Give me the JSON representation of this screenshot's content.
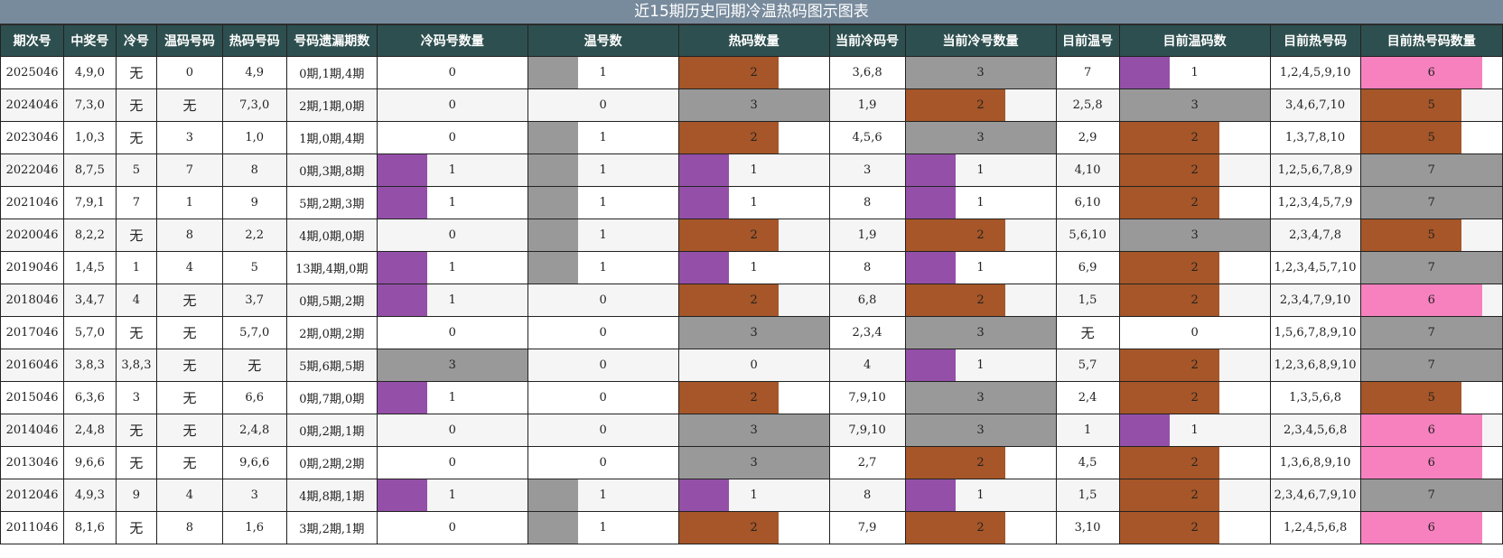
{
  "title": "近15期历史同期冷温热码图示图表",
  "headers": [
    "期次号",
    "中奖号",
    "冷号",
    "温码号码",
    "热码号码",
    "号码遗漏期数",
    "冷码号数量",
    "温号数",
    "热码数量",
    "当前冷码号",
    "当前冷号数量",
    "目前温号",
    "目前温码数",
    "目前热号码",
    "目前热号码数量"
  ],
  "bar_colors": {
    "0": "",
    "1": "#9450a8",
    "2": "#a65628",
    "3": "#999999",
    "5": "#a65628",
    "6": "#f781bf",
    "7": "#999999"
  },
  "rows": [
    {
      "issue": "2025046",
      "winning": "4,9,0",
      "cold": "无",
      "warm": "0",
      "hot": "4,9",
      "miss": "0期,1期,4期",
      "cold_count": 0,
      "warm_count": 1,
      "hot_count": 2,
      "cur_cold": "3,6,8",
      "cur_cold_count": 3,
      "cur_warm": "7",
      "cur_warm_count": 1,
      "cur_hot": "1,2,4,5,9,10",
      "cur_hot_count": 6
    },
    {
      "issue": "2024046",
      "winning": "7,3,0",
      "cold": "无",
      "warm": "无",
      "hot": "7,3,0",
      "miss": "2期,1期,0期",
      "cold_count": 0,
      "warm_count": 0,
      "hot_count": 3,
      "cur_cold": "1,9",
      "cur_cold_count": 2,
      "cur_warm": "2,5,8",
      "cur_warm_count": 3,
      "cur_hot": "3,4,6,7,10",
      "cur_hot_count": 5
    },
    {
      "issue": "2023046",
      "winning": "1,0,3",
      "cold": "无",
      "warm": "3",
      "hot": "1,0",
      "miss": "1期,0期,4期",
      "cold_count": 0,
      "warm_count": 1,
      "hot_count": 2,
      "cur_cold": "4,5,6",
      "cur_cold_count": 3,
      "cur_warm": "2,9",
      "cur_warm_count": 2,
      "cur_hot": "1,3,7,8,10",
      "cur_hot_count": 5
    },
    {
      "issue": "2022046",
      "winning": "8,7,5",
      "cold": "5",
      "warm": "7",
      "hot": "8",
      "miss": "0期,3期,8期",
      "cold_count": 1,
      "warm_count": 1,
      "hot_count": 1,
      "cur_cold": "3",
      "cur_cold_count": 1,
      "cur_warm": "4,10",
      "cur_warm_count": 2,
      "cur_hot": "1,2,5,6,7,8,9",
      "cur_hot_count": 7
    },
    {
      "issue": "2021046",
      "winning": "7,9,1",
      "cold": "7",
      "warm": "1",
      "hot": "9",
      "miss": "5期,2期,3期",
      "cold_count": 1,
      "warm_count": 1,
      "hot_count": 1,
      "cur_cold": "8",
      "cur_cold_count": 1,
      "cur_warm": "6,10",
      "cur_warm_count": 2,
      "cur_hot": "1,2,3,4,5,7,9",
      "cur_hot_count": 7
    },
    {
      "issue": "2020046",
      "winning": "8,2,2",
      "cold": "无",
      "warm": "8",
      "hot": "2,2",
      "miss": "4期,0期,0期",
      "cold_count": 0,
      "warm_count": 1,
      "hot_count": 2,
      "cur_cold": "1,9",
      "cur_cold_count": 2,
      "cur_warm": "5,6,10",
      "cur_warm_count": 3,
      "cur_hot": "2,3,4,7,8",
      "cur_hot_count": 5
    },
    {
      "issue": "2019046",
      "winning": "1,4,5",
      "cold": "1",
      "warm": "4",
      "hot": "5",
      "miss": "13期,4期,0期",
      "cold_count": 1,
      "warm_count": 1,
      "hot_count": 1,
      "cur_cold": "8",
      "cur_cold_count": 1,
      "cur_warm": "6,9",
      "cur_warm_count": 2,
      "cur_hot": "1,2,3,4,5,7,10",
      "cur_hot_count": 7
    },
    {
      "issue": "2018046",
      "winning": "3,4,7",
      "cold": "4",
      "warm": "无",
      "hot": "3,7",
      "miss": "0期,5期,2期",
      "cold_count": 1,
      "warm_count": 0,
      "hot_count": 2,
      "cur_cold": "6,8",
      "cur_cold_count": 2,
      "cur_warm": "1,5",
      "cur_warm_count": 2,
      "cur_hot": "2,3,4,7,9,10",
      "cur_hot_count": 6
    },
    {
      "issue": "2017046",
      "winning": "5,7,0",
      "cold": "无",
      "warm": "无",
      "hot": "5,7,0",
      "miss": "2期,0期,2期",
      "cold_count": 0,
      "warm_count": 0,
      "hot_count": 3,
      "cur_cold": "2,3,4",
      "cur_cold_count": 3,
      "cur_warm": "无",
      "cur_warm_count": 0,
      "cur_hot": "1,5,6,7,8,9,10",
      "cur_hot_count": 7
    },
    {
      "issue": "2016046",
      "winning": "3,8,3",
      "cold": "3,8,3",
      "warm": "无",
      "hot": "无",
      "miss": "5期,6期,5期",
      "cold_count": 3,
      "warm_count": 0,
      "hot_count": 0,
      "cur_cold": "4",
      "cur_cold_count": 1,
      "cur_warm": "5,7",
      "cur_warm_count": 2,
      "cur_hot": "1,2,3,6,8,9,10",
      "cur_hot_count": 7
    },
    {
      "issue": "2015046",
      "winning": "6,3,6",
      "cold": "3",
      "warm": "无",
      "hot": "6,6",
      "miss": "0期,7期,0期",
      "cold_count": 1,
      "warm_count": 0,
      "hot_count": 2,
      "cur_cold": "7,9,10",
      "cur_cold_count": 3,
      "cur_warm": "2,4",
      "cur_warm_count": 2,
      "cur_hot": "1,3,5,6,8",
      "cur_hot_count": 5
    },
    {
      "issue": "2014046",
      "winning": "2,4,8",
      "cold": "无",
      "warm": "无",
      "hot": "2,4,8",
      "miss": "0期,2期,1期",
      "cold_count": 0,
      "warm_count": 0,
      "hot_count": 3,
      "cur_cold": "7,9,10",
      "cur_cold_count": 3,
      "cur_warm": "1",
      "cur_warm_count": 1,
      "cur_hot": "2,3,4,5,6,8",
      "cur_hot_count": 6
    },
    {
      "issue": "2013046",
      "winning": "9,6,6",
      "cold": "无",
      "warm": "无",
      "hot": "9,6,6",
      "miss": "0期,2期,2期",
      "cold_count": 0,
      "warm_count": 0,
      "hot_count": 3,
      "cur_cold": "2,7",
      "cur_cold_count": 2,
      "cur_warm": "4,5",
      "cur_warm_count": 2,
      "cur_hot": "1,3,6,8,9,10",
      "cur_hot_count": 6
    },
    {
      "issue": "2012046",
      "winning": "4,9,3",
      "cold": "9",
      "warm": "4",
      "hot": "3",
      "miss": "4期,8期,1期",
      "cold_count": 1,
      "warm_count": 1,
      "hot_count": 1,
      "cur_cold": "8",
      "cur_cold_count": 1,
      "cur_warm": "1,5",
      "cur_warm_count": 2,
      "cur_hot": "2,3,4,6,7,9,10",
      "cur_hot_count": 7
    },
    {
      "issue": "2011046",
      "winning": "8,1,6",
      "cold": "无",
      "warm": "8",
      "hot": "1,6",
      "miss": "3期,2期,1期",
      "cold_count": 0,
      "warm_count": 1,
      "hot_count": 2,
      "cur_cold": "7,9",
      "cur_cold_count": 2,
      "cur_warm": "3,10",
      "cur_warm_count": 2,
      "cur_hot": "1,2,4,5,6,8",
      "cur_hot_count": 6
    }
  ]
}
